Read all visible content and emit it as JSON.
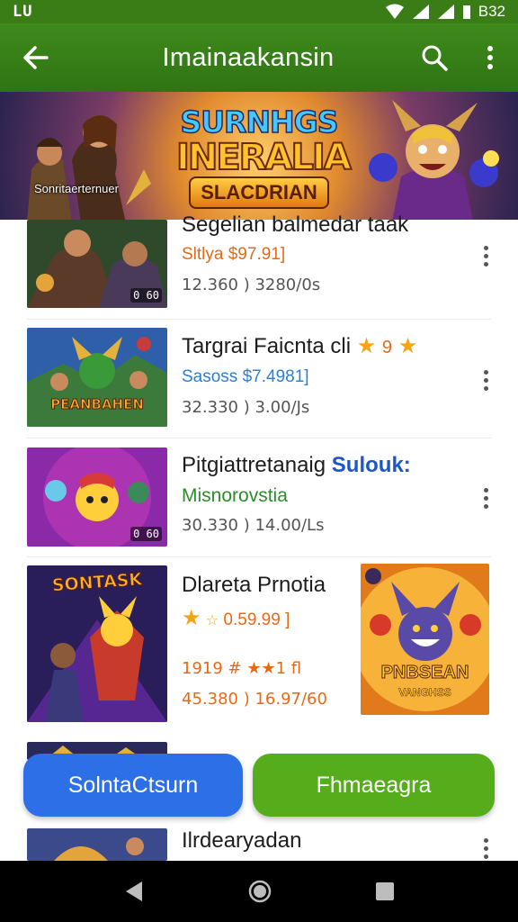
{
  "status_bar": {
    "left": "LU",
    "time": "B32"
  },
  "app_bar": {
    "title": "Imainaakansin"
  },
  "banner": {
    "logo_line1": "SURNHGS",
    "logo_line2": "INERALIA",
    "logo_line3": "SLACDRIAN",
    "caption": "Sonritaerternuer"
  },
  "items": [
    {
      "title": "Segelian balmedar taak",
      "subtitle": "Sltlya $97.91]",
      "meta": "12.360 )  3280/0s",
      "badge": "0 60"
    },
    {
      "title": "Targrai Faicnta cli",
      "rating_text": "9",
      "subtitle": "Sasoss $7.4981]",
      "meta": "32.330 )  3.00/Js",
      "thumb_caption": "PEANBAHEN"
    },
    {
      "title": "Pitgiattretanaig",
      "title_highlight": "Sulouk:",
      "subtitle": "Misnorovstia",
      "meta": "30.330 )  14.00/Ls",
      "badge": "0 60"
    },
    {
      "title": "Dlareta Prnotia",
      "rating_text": "0.59.99 ]",
      "meta_line1": "1919 # ★★1 fl",
      "meta": "45.380 )  16.97/60",
      "thumb_caption": "SONTASK",
      "side_caption_1": "PNBSEAN",
      "side_caption_2": "VANGHSS"
    },
    {
      "title": "Ilrdearyadan"
    }
  ],
  "buttons": {
    "left_label": "SolntaCtsurn",
    "right_label": "Fhmaeagra"
  },
  "colors": {
    "app_bar": "#3a7d17",
    "blue_button": "#2d6fe6",
    "green_button": "#55ad1c",
    "star": "#f3a514",
    "price_orange": "#e56a17",
    "price_blue": "#2a7fd5",
    "sub_green": "#2a8d2a",
    "highlight_blue": "#1d56c8"
  }
}
